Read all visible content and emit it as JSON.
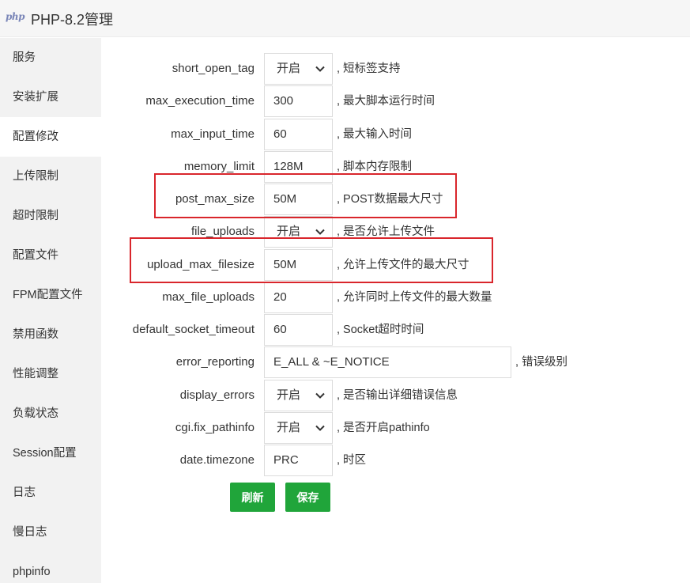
{
  "window": {
    "logo_text": "php",
    "title": "PHP-8.2管理"
  },
  "sidebar": {
    "items": [
      {
        "label": "服务"
      },
      {
        "label": "安装扩展"
      },
      {
        "label": "配置修改"
      },
      {
        "label": "上传限制"
      },
      {
        "label": "超时限制"
      },
      {
        "label": "配置文件"
      },
      {
        "label": "FPM配置文件"
      },
      {
        "label": "禁用函数"
      },
      {
        "label": "性能调整"
      },
      {
        "label": "负载状态"
      },
      {
        "label": "Session配置"
      },
      {
        "label": "日志"
      },
      {
        "label": "慢日志"
      },
      {
        "label": "phpinfo"
      }
    ],
    "active_index": 2
  },
  "form": {
    "rows": [
      {
        "label": "short_open_tag",
        "type": "select",
        "value": "开启",
        "desc": ", 短标签支持"
      },
      {
        "label": "max_execution_time",
        "type": "input",
        "value": "300",
        "desc": ", 最大脚本运行时间"
      },
      {
        "label": "max_input_time",
        "type": "input",
        "value": "60",
        "desc": ", 最大输入时间"
      },
      {
        "label": "memory_limit",
        "type": "input",
        "value": "128M",
        "desc": ", 脚本内存限制"
      },
      {
        "label": "post_max_size",
        "type": "input",
        "value": "50M",
        "desc": ", POST数据最大尺寸"
      },
      {
        "label": "file_uploads",
        "type": "select",
        "value": "开启",
        "desc": ", 是否允许上传文件"
      },
      {
        "label": "upload_max_filesize",
        "type": "input",
        "value": "50M",
        "desc": ", 允许上传文件的最大尺寸"
      },
      {
        "label": "max_file_uploads",
        "type": "input",
        "value": "20",
        "desc": ", 允许同时上传文件的最大数量"
      },
      {
        "label": "default_socket_timeout",
        "type": "input",
        "value": "60",
        "desc": ", Socket超时时间"
      },
      {
        "label": "error_reporting",
        "type": "input",
        "value": "E_ALL & ~E_NOTICE",
        "desc": ", 错误级别"
      },
      {
        "label": "display_errors",
        "type": "select",
        "value": "开启",
        "desc": ", 是否输出详细错误信息"
      },
      {
        "label": "cgi.fix_pathinfo",
        "type": "select",
        "value": "开启",
        "desc": ", 是否开启pathinfo"
      },
      {
        "label": "date.timezone",
        "type": "input",
        "value": "PRC",
        "desc": ", 时区"
      }
    ]
  },
  "buttons": {
    "refresh_label": "刷新",
    "save_label": "保存"
  },
  "colors": {
    "accent": "#20a53a",
    "highlight": "#d9262c",
    "sidebar_bg": "#f2f2f2"
  }
}
